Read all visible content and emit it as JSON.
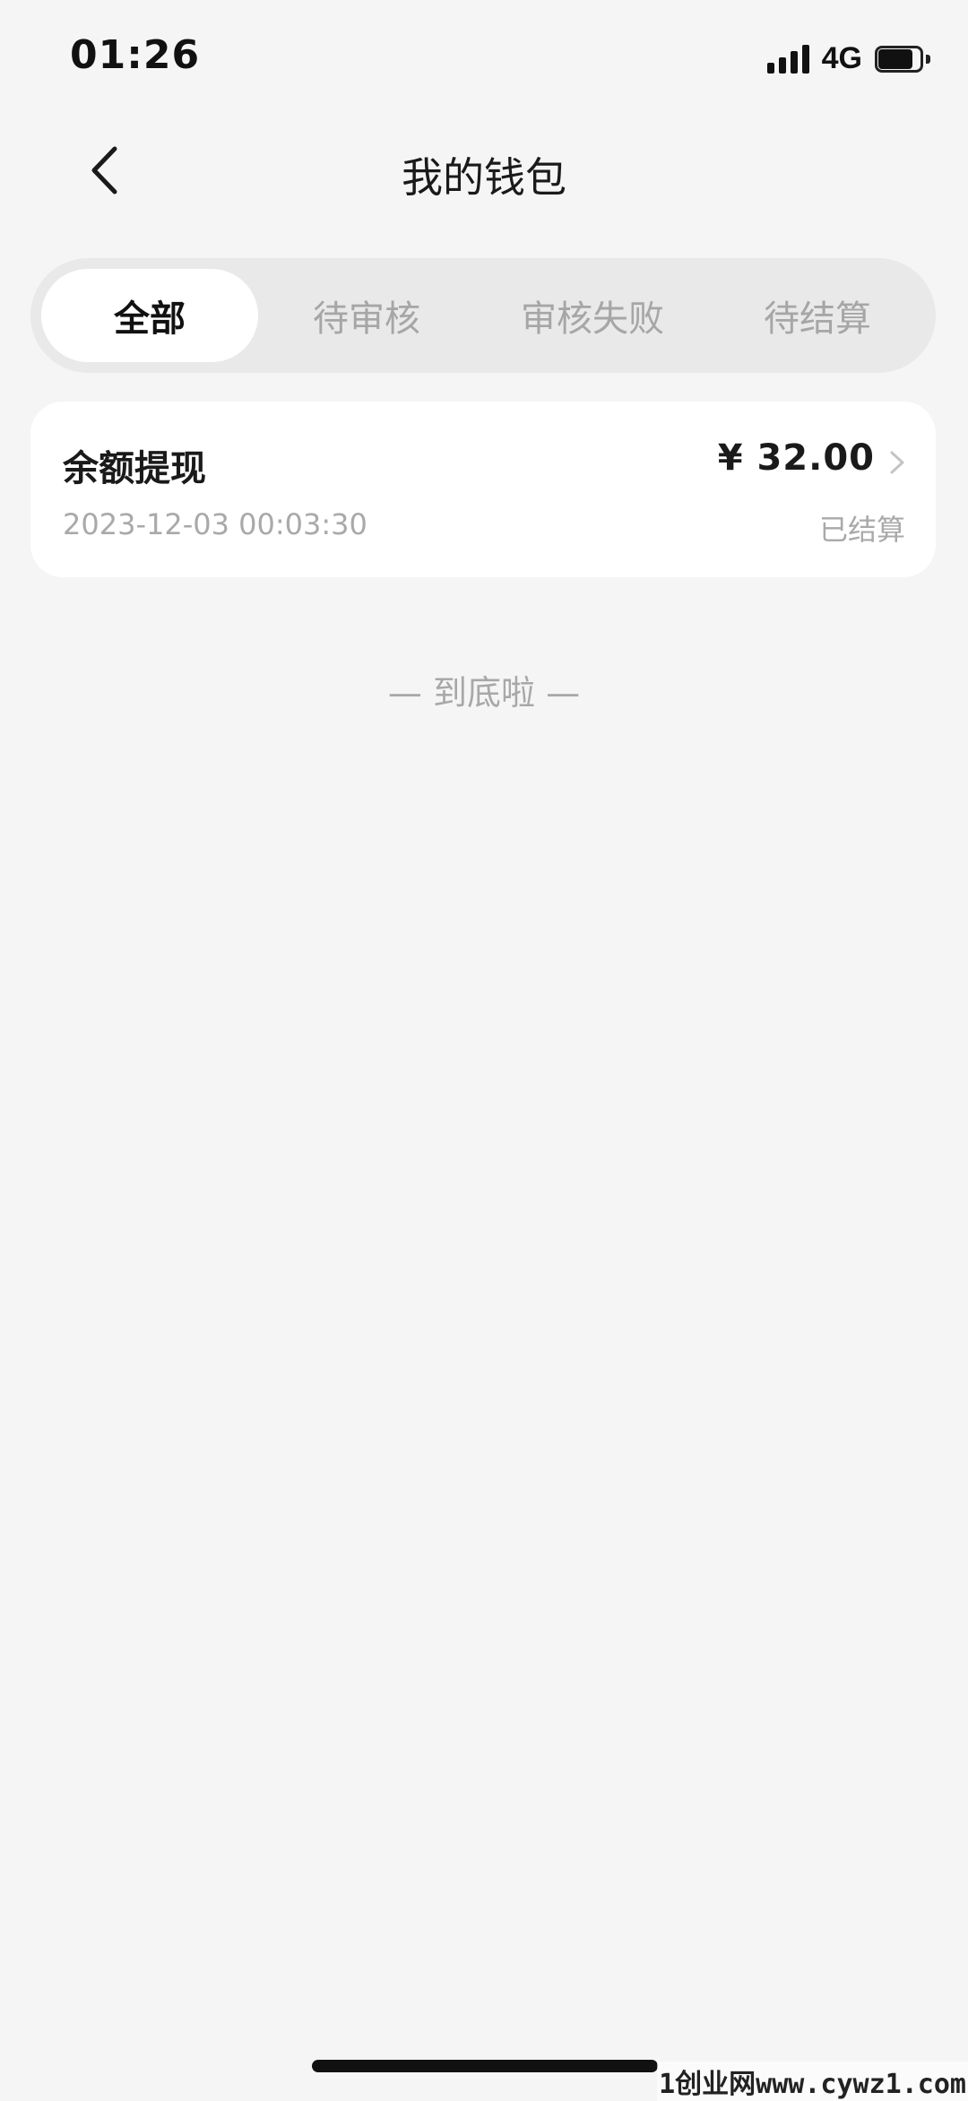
{
  "status_bar": {
    "time": "01:26",
    "network": "4G",
    "signal_icon": "signal-bars-icon",
    "battery_icon": "battery-icon"
  },
  "header": {
    "title": "我的钱包",
    "back_icon": "chevron-left-icon"
  },
  "tabs": [
    {
      "label": "全部",
      "active": true
    },
    {
      "label": "待审核",
      "active": false
    },
    {
      "label": "审核失败",
      "active": false
    },
    {
      "label": "待结算",
      "active": false
    }
  ],
  "records": [
    {
      "title": "余额提现",
      "amount": "¥ 32.00",
      "time": "2023-12-03 00:03:30",
      "status": "已结算"
    }
  ],
  "list_footer": "— 到底啦 —",
  "watermark": "1创业网www.cywz1.com",
  "colors": {
    "background": "#f5f5f5",
    "card": "#ffffff",
    "tab_track": "#e9e9e9",
    "muted_text": "#a9a9a9",
    "primary_text": "#1a1a1a"
  }
}
